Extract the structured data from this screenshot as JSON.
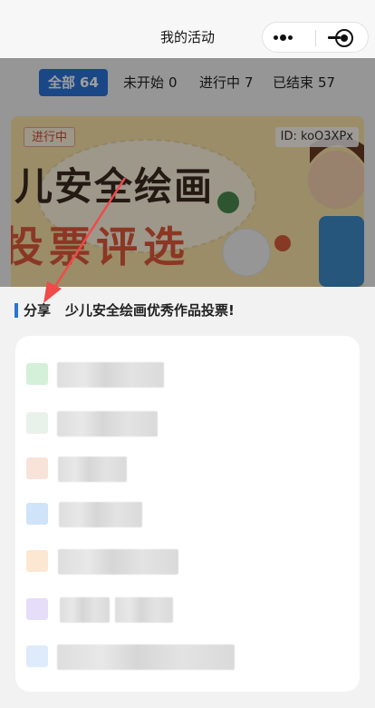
{
  "nav": {
    "title": "我的活动"
  },
  "tabs": [
    {
      "label": "全部",
      "count": "64"
    },
    {
      "label": "未开始",
      "count": "0"
    },
    {
      "label": "进行中",
      "count": "7"
    },
    {
      "label": "已结束",
      "count": "57"
    }
  ],
  "banner": {
    "status": "进行中",
    "id_text": "ID: koO3XPx",
    "line1": "儿安全绘画",
    "line2": "投票评选",
    "colors": {
      "bg": "#fbe4a6",
      "text": "#3a2a1f",
      "accent": "#e15a3a"
    }
  },
  "share_label": "分享",
  "activity_title": "少儿安全绘画优秀作品投票!",
  "share_options": [
    {
      "color": "#d4f0d8"
    },
    {
      "color": "#e9f2ea"
    },
    {
      "color": "#f8e3d8"
    },
    {
      "color": "#cfe3f9"
    },
    {
      "color": "#fce7d2"
    },
    {
      "color": "#e6ddf8"
    },
    {
      "color": "#deebfb"
    }
  ],
  "accent_color": "#2a73d8"
}
